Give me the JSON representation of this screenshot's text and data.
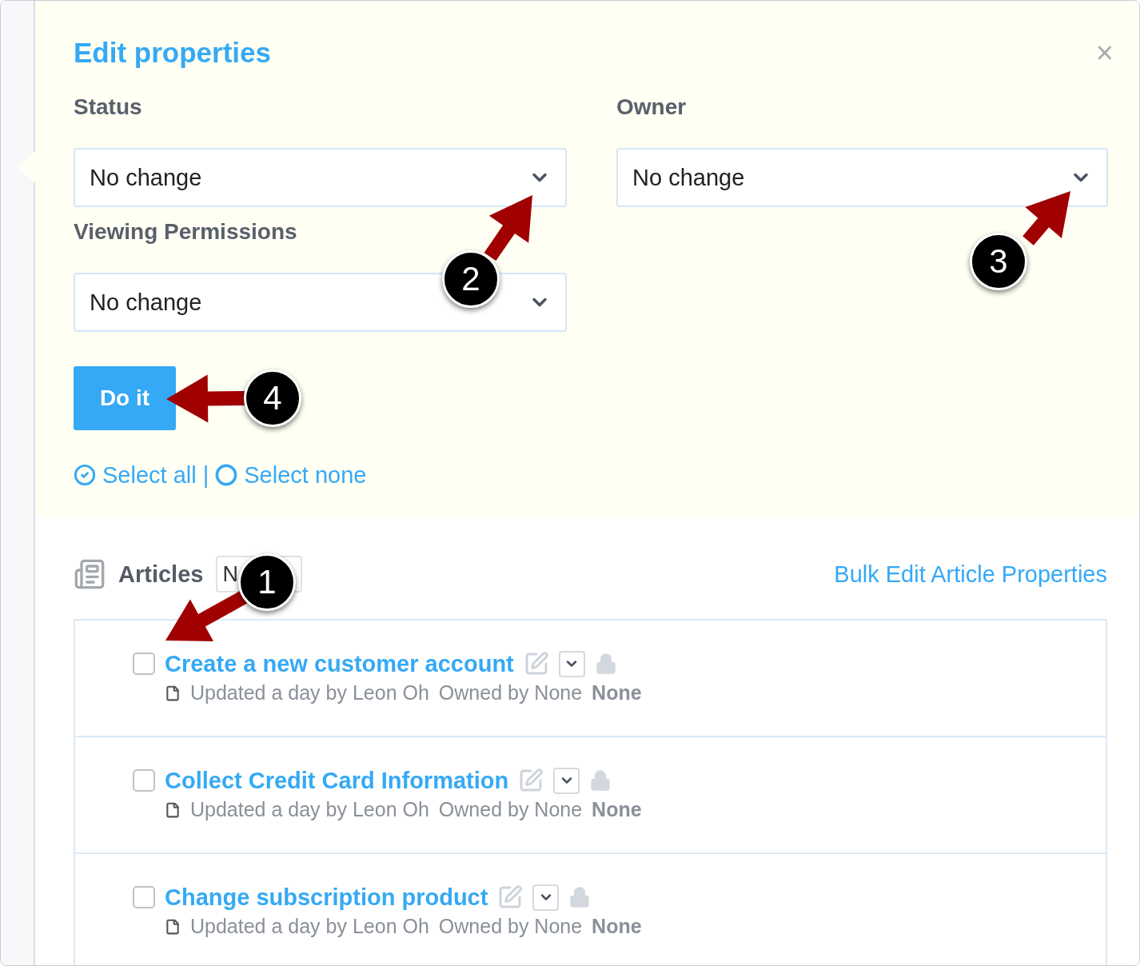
{
  "dialog": {
    "title": "Edit properties",
    "close": "×",
    "fields": [
      {
        "label": "Status",
        "value": "No change"
      },
      {
        "label": "Owner",
        "value": "No change"
      },
      {
        "label": "Viewing Permissions",
        "value": "No change"
      }
    ],
    "submit": "Do it",
    "select_all": "Select all",
    "separator": "|",
    "select_none": "Select none"
  },
  "articles": {
    "title": "Articles",
    "button": "N",
    "bulk_edit": "Bulk Edit Article Properties",
    "items": [
      {
        "title": "Create a new customer account",
        "checked": false,
        "meta": "Updated a day by Leon Oh",
        "owner": "Owned by None",
        "status": "None"
      },
      {
        "title": "Collect Credit Card Information",
        "checked": false,
        "meta": "Updated a day by Leon Oh",
        "owner": "Owned by None",
        "status": "None"
      },
      {
        "title": "Change subscription product",
        "checked": false,
        "meta": "Updated a day by Leon Oh",
        "owner": "Owned by None",
        "status": "None"
      }
    ]
  },
  "callouts": [
    "1",
    "2",
    "3",
    "4"
  ]
}
